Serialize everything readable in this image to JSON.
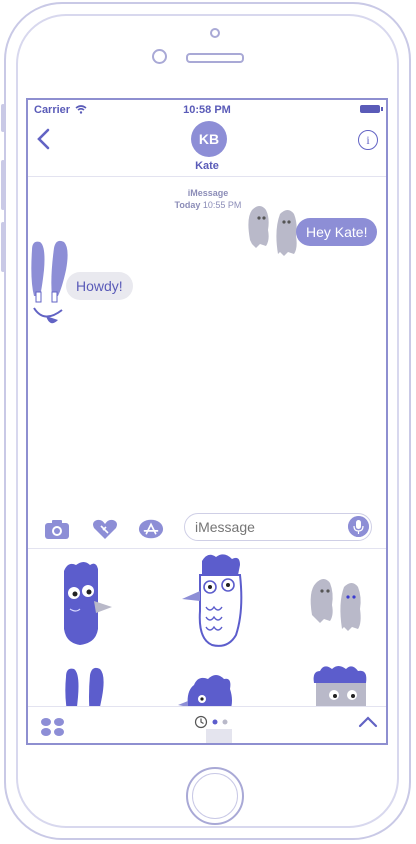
{
  "status_bar": {
    "carrier": "Carrier",
    "time": "10:58 PM"
  },
  "conversation": {
    "contact_initials": "KB",
    "contact_name": "Kate",
    "service": "iMessage",
    "timestamp_day": "Today",
    "timestamp_time": "10:55 PM",
    "messages": [
      {
        "direction": "outgoing",
        "text": "Hey Kate!"
      },
      {
        "direction": "incoming",
        "text": "Howdy!"
      }
    ]
  },
  "compose": {
    "placeholder": "iMessage"
  },
  "colors": {
    "accent": "#6263c4",
    "bubble_out": "#8d8ed6",
    "bubble_in": "#e9e9ef",
    "sticker": "#5c5dcc"
  },
  "icons": [
    "back-icon",
    "info-icon",
    "camera-icon",
    "digital-touch-icon",
    "app-store-icon",
    "microphone-icon",
    "apps-icon",
    "recents-icon",
    "chevron-up-icon"
  ]
}
